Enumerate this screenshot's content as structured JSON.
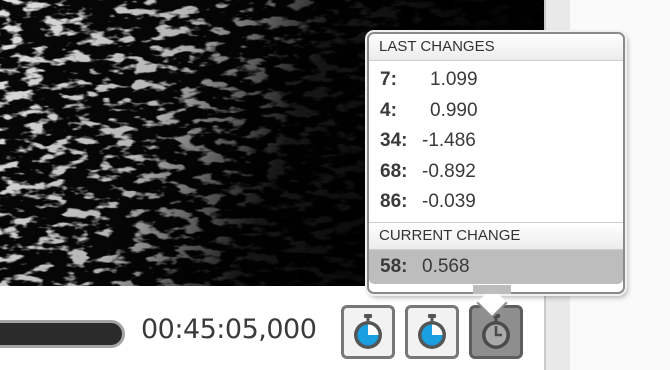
{
  "player": {
    "timecode": "00:45:05,000",
    "buttons": [
      {
        "name": "stopwatch-blue",
        "icon": "stopwatch-icon",
        "active": false
      },
      {
        "name": "stopwatch-blue",
        "icon": "stopwatch-icon",
        "active": false
      },
      {
        "name": "stopwatch-gray",
        "icon": "stopwatch-icon",
        "active": true
      }
    ]
  },
  "popup": {
    "last_changes_header": "LAST CHANGES",
    "last_changes": [
      {
        "key": "7:",
        "value": "1.099"
      },
      {
        "key": "4:",
        "value": "0.990"
      },
      {
        "key": "34:",
        "value": "-1.486"
      },
      {
        "key": "68:",
        "value": "-0.892"
      },
      {
        "key": "86:",
        "value": "-0.039"
      }
    ],
    "current_change_header": "CURRENT CHANGE",
    "current_change": {
      "key": "58:",
      "value": "0.568"
    }
  },
  "colors": {
    "accent_blue": "#1a9fe0",
    "active_button": "#8e8e8e",
    "current_row": "#bdbdbd"
  }
}
